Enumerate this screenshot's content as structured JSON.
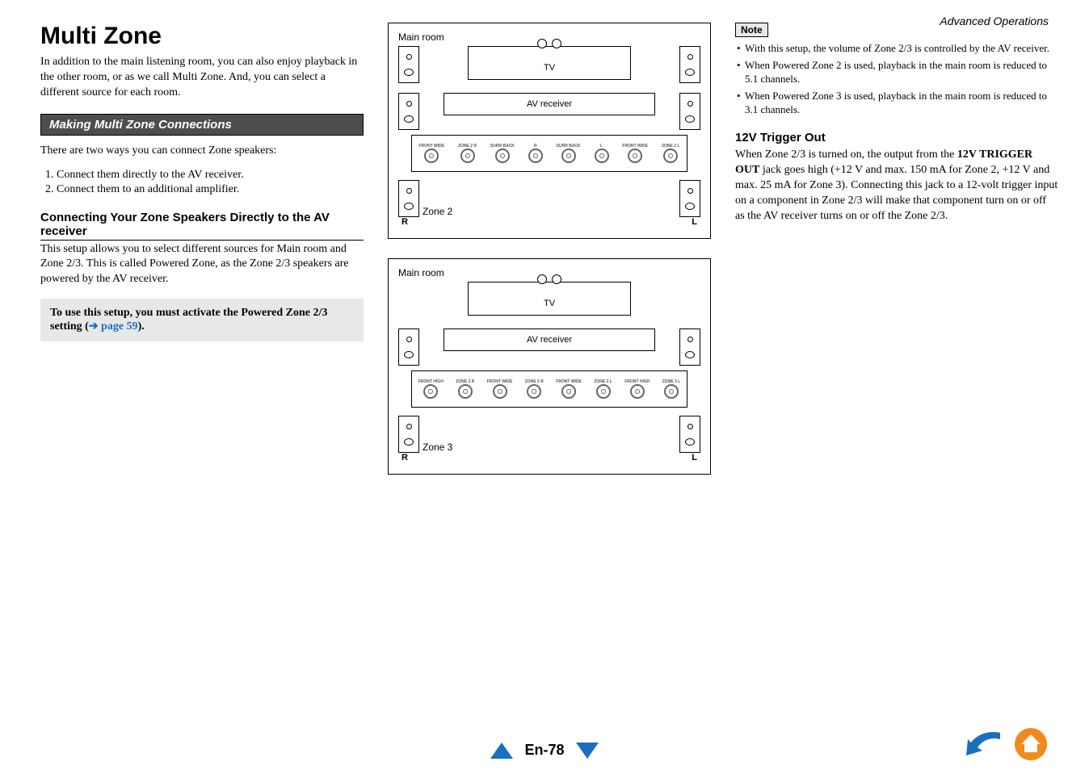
{
  "header": {
    "section": "Advanced Operations"
  },
  "main": {
    "title": "Multi Zone",
    "intro": "In addition to the main listening room, you can also enjoy playback in the other room, or as we call Multi Zone. And, you can select a different source for each room.",
    "sectionBar": "Making Multi Zone Connections",
    "twoWays": "There are two ways you can connect Zone speakers:",
    "ways": [
      "Connect them directly to the AV receiver.",
      "Connect them to an additional amplifier."
    ],
    "subhead": "Connecting Your Zone Speakers Directly to the AV receiver",
    "subdesc": "This setup allows you to select different sources for Main room and Zone 2/3. This is called Powered Zone, as the Zone 2/3 speakers are powered by the AV receiver.",
    "setupNote_a": "To use this setup, you must activate the Powered Zone 2/3 setting (",
    "setupNote_link": "➔ page 59",
    "setupNote_b": ")."
  },
  "diagram": {
    "mainRoom": "Main room",
    "tv": "TV",
    "av": "AV receiver",
    "zone2": "Zone 2",
    "zone3": "Zone 3",
    "R": "R",
    "L": "L",
    "terms1": [
      "FRONT WIDE",
      "ZONE 2 R",
      "SURR BACK",
      "R",
      "SURR BACK",
      "L",
      "FRONT WIDE",
      "ZONE 2 L"
    ],
    "terms2": [
      "FRONT HIGH",
      "ZONE 3 R",
      "FRONT WIDE",
      "ZONE 2 R",
      "FRONT WIDE",
      "ZONE 2 L",
      "FRONT HIGH",
      "ZONE 3 L"
    ]
  },
  "right": {
    "noteLabel": "Note",
    "notes": [
      "With this setup, the volume of Zone 2/3 is controlled by the AV receiver.",
      "When Powered Zone 2 is used, playback in the main room is reduced to 5.1 channels.",
      "When Powered Zone 3 is used, playback in the main room is reduced to 3.1 channels."
    ],
    "triggerHead": "12V Trigger Out",
    "trigger_a": "When Zone 2/3 is turned on, the output from the ",
    "trigger_b": "12V TRIGGER OUT",
    "trigger_c": " jack goes high (+12 V and max. 150 mA for Zone 2, +12 V and max. 25 mA for Zone 3). Connecting this jack to a 12-volt trigger input on a component in Zone 2/3 will make that component turn on or off as the AV receiver turns on or off the Zone 2/3."
  },
  "footer": {
    "page": "En-78"
  }
}
